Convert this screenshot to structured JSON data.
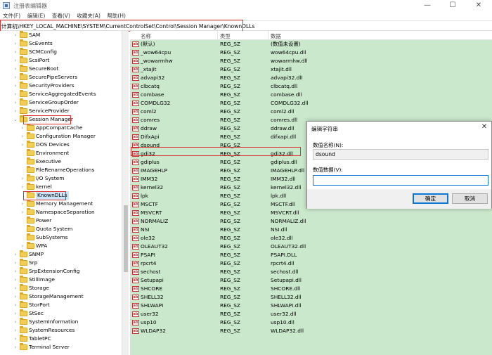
{
  "window": {
    "title": "注册表编辑器",
    "minimize_glyph": "—",
    "maximize_glyph": "☐",
    "close_glyph": "✕"
  },
  "menu": [
    "文件(F)",
    "编辑(E)",
    "查看(V)",
    "收藏夹(A)",
    "帮助(H)"
  ],
  "address": "计算机\\HKEY_LOCAL_MACHINE\\SYSTEM\\CurrentControlSet\\Control\\Session Manager\\KnownDLLs",
  "tree": {
    "top_level": [
      "SAM",
      "ScEvents",
      "SCMConfig",
      "ScsiPort",
      "SecureBoot",
      "SecurePipeServers",
      "SecurityProviders",
      "ServiceAggregatedEvents",
      "ServiceGroupOrder",
      "ServiceProvider"
    ],
    "session_manager": "Session Manager",
    "children": [
      "AppCompatCache",
      "Configuration Manager",
      "DOS Devices",
      "Environment",
      "Executive",
      "FileRenameOperations",
      "I/O System",
      "kernel",
      "KnownDLLs",
      "Memory Management",
      "NamespaceSeparation",
      "Power",
      "Quota System",
      "SubSystems",
      "WPA"
    ],
    "after": [
      "SNMP",
      "Srp",
      "SrpExtensionConfig",
      "StillImage",
      "Storage",
      "StorageManagement",
      "StorPort",
      "StSec",
      "SystemInformation",
      "SystemResources",
      "TabletPC",
      "Terminal Server"
    ]
  },
  "list": {
    "headers": {
      "name": "名称",
      "type": "类型",
      "data": "数据"
    },
    "rows": [
      {
        "name": "(默认)",
        "type": "REG_SZ",
        "data": "(数值未设置)"
      },
      {
        "name": "_wow64cpu",
        "type": "REG_SZ",
        "data": "wow64cpu.dll"
      },
      {
        "name": "_wowarmhw",
        "type": "REG_SZ",
        "data": "wowarmhw.dll"
      },
      {
        "name": "_xtajit",
        "type": "REG_SZ",
        "data": "xtajit.dll"
      },
      {
        "name": "advapi32",
        "type": "REG_SZ",
        "data": "advapi32.dll"
      },
      {
        "name": "clbcatq",
        "type": "REG_SZ",
        "data": "clbcatq.dll"
      },
      {
        "name": "combase",
        "type": "REG_SZ",
        "data": "combase.dll"
      },
      {
        "name": "COMDLG32",
        "type": "REG_SZ",
        "data": "COMDLG32.dll"
      },
      {
        "name": "coml2",
        "type": "REG_SZ",
        "data": "coml2.dll"
      },
      {
        "name": "comres",
        "type": "REG_SZ",
        "data": "comres.dll"
      },
      {
        "name": "ddraw",
        "type": "REG_SZ",
        "data": "ddraw.dll"
      },
      {
        "name": "DifxApi",
        "type": "REG_SZ",
        "data": "difxapi.dll"
      },
      {
        "name": "dsound",
        "type": "REG_SZ",
        "data": ""
      },
      {
        "name": "gdi32",
        "type": "REG_SZ",
        "data": "gdi32.dll"
      },
      {
        "name": "gdiplus",
        "type": "REG_SZ",
        "data": "gdiplus.dll"
      },
      {
        "name": "IMAGEHLP",
        "type": "REG_SZ",
        "data": "IMAGEHLP.dll"
      },
      {
        "name": "IMM32",
        "type": "REG_SZ",
        "data": "IMM32.dll"
      },
      {
        "name": "kernel32",
        "type": "REG_SZ",
        "data": "kernel32.dll"
      },
      {
        "name": "lpk",
        "type": "REG_SZ",
        "data": "lpk.dll"
      },
      {
        "name": "MSCTF",
        "type": "REG_SZ",
        "data": "MSCTF.dll"
      },
      {
        "name": "MSVCRT",
        "type": "REG_SZ",
        "data": "MSVCRT.dll"
      },
      {
        "name": "NORMALIZ",
        "type": "REG_SZ",
        "data": "NORMALIZ.dll"
      },
      {
        "name": "NSI",
        "type": "REG_SZ",
        "data": "NSI.dll"
      },
      {
        "name": "ole32",
        "type": "REG_SZ",
        "data": "ole32.dll"
      },
      {
        "name": "OLEAUT32",
        "type": "REG_SZ",
        "data": "OLEAUT32.dll"
      },
      {
        "name": "PSAPI",
        "type": "REG_SZ",
        "data": "PSAPI.DLL"
      },
      {
        "name": "rpcrt4",
        "type": "REG_SZ",
        "data": "rpcrt4.dll"
      },
      {
        "name": "sechost",
        "type": "REG_SZ",
        "data": "sechost.dll"
      },
      {
        "name": "Setupapi",
        "type": "REG_SZ",
        "data": "Setupapi.dll"
      },
      {
        "name": "SHCORE",
        "type": "REG_SZ",
        "data": "SHCORE.dll"
      },
      {
        "name": "SHELL32",
        "type": "REG_SZ",
        "data": "SHELL32.dll"
      },
      {
        "name": "SHLWAPI",
        "type": "REG_SZ",
        "data": "SHLWAPI.dll"
      },
      {
        "name": "user32",
        "type": "REG_SZ",
        "data": "user32.dll"
      },
      {
        "name": "usp10",
        "type": "REG_SZ",
        "data": "usp10.dll"
      },
      {
        "name": "WLDAP32",
        "type": "REG_SZ",
        "data": "WLDAP32.dll"
      }
    ]
  },
  "dialog": {
    "title": "编辑字符串",
    "name_label": "数值名称(N):",
    "name_value": "dsound",
    "data_label": "数值数据(V):",
    "data_value": "",
    "ok": "确定",
    "cancel": "取消"
  }
}
